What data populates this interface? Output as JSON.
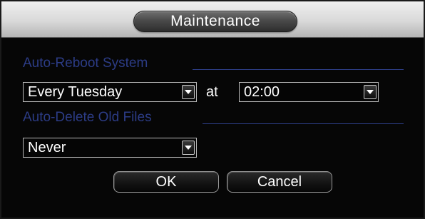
{
  "window": {
    "title": "Maintenance"
  },
  "auto_reboot": {
    "section_label": "Auto-Reboot System",
    "schedule_value": "Every Tuesday",
    "at_label": "at",
    "time_value": "02:00"
  },
  "auto_delete": {
    "section_label": "Auto-Delete Old Files",
    "value": "Never"
  },
  "buttons": {
    "ok_label": "OK",
    "cancel_label": "Cancel"
  },
  "colors": {
    "section_label": "#2c3c86",
    "background": "#060606",
    "text": "#ffffff"
  },
  "icons": {
    "dropdown": "chevron-down-icon"
  }
}
